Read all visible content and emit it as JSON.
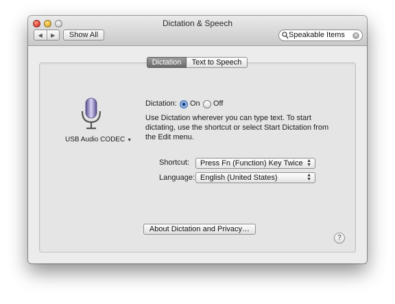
{
  "window": {
    "title": "Dictation & Speech"
  },
  "toolbar": {
    "back_glyph": "◀",
    "forward_glyph": "▶",
    "show_all_label": "Show All",
    "search_value": "Speakable Items"
  },
  "tabs": [
    {
      "label": "Dictation",
      "selected": true
    },
    {
      "label": "Text to Speech",
      "selected": false
    }
  ],
  "mic": {
    "icon": "microphone-icon",
    "source_label": "USB Audio CODEC"
  },
  "dictation": {
    "label": "Dictation:",
    "on_label": "On",
    "off_label": "Off",
    "selected": "On",
    "description": "Use Dictation wherever you can type text. To start dictating, use the shortcut or select Start Dictation from the Edit menu."
  },
  "shortcut": {
    "label": "Shortcut:",
    "value": "Press Fn (Function) Key Twice"
  },
  "language": {
    "label": "Language:",
    "value": "English (United States)"
  },
  "about_label": "About Dictation and Privacy…",
  "help_label": "?",
  "colors": {
    "accent": "#6a9ad8",
    "selected_tab": "#7a7a7a"
  }
}
